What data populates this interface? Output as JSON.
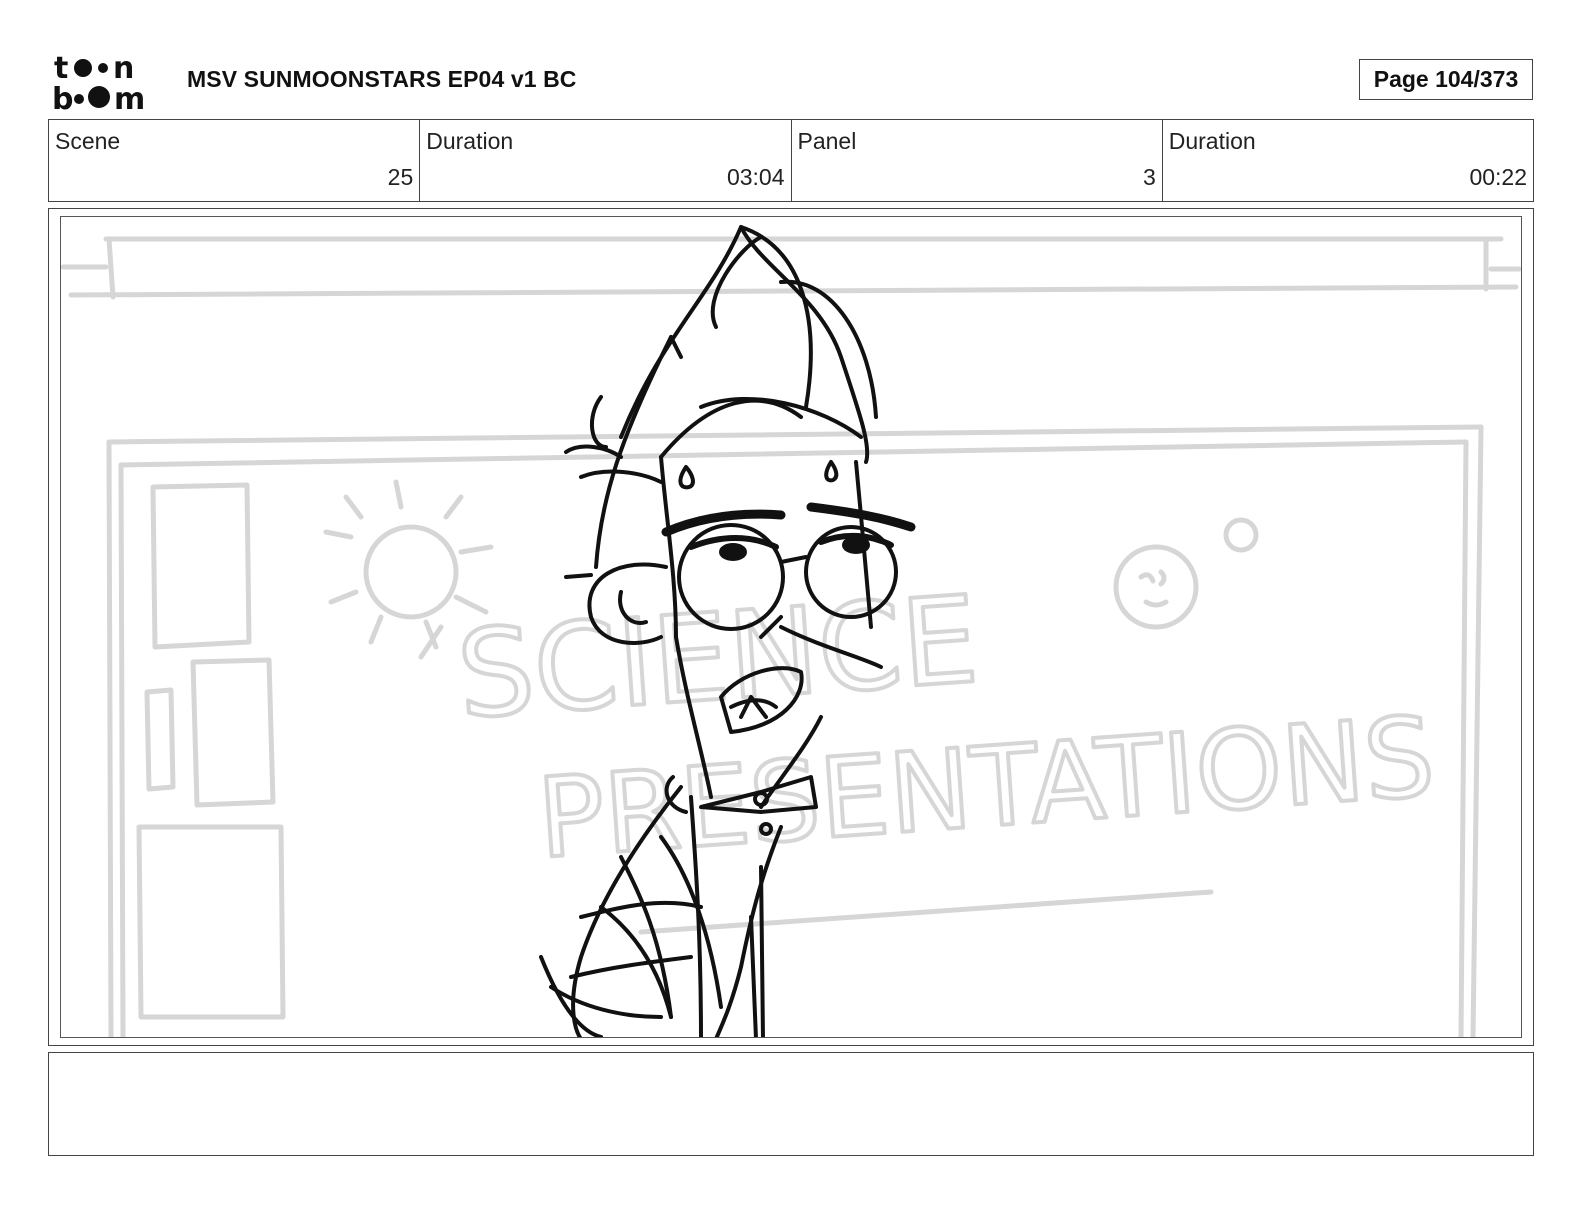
{
  "header": {
    "logo_text": "toon boom",
    "title": "MSV SUNMOONSTARS EP04 v1 BC",
    "page": "Page 104/373"
  },
  "info": [
    {
      "label": "Scene",
      "value": "25"
    },
    {
      "label": "Duration",
      "value": "03:04"
    },
    {
      "label": "Panel",
      "value": "3"
    },
    {
      "label": "Duration",
      "value": "00:22"
    }
  ],
  "panel": {
    "board_text_line1": "SCIENCE",
    "board_text_line2": "PRESENTATIONS"
  },
  "notes": {
    "text": ""
  }
}
